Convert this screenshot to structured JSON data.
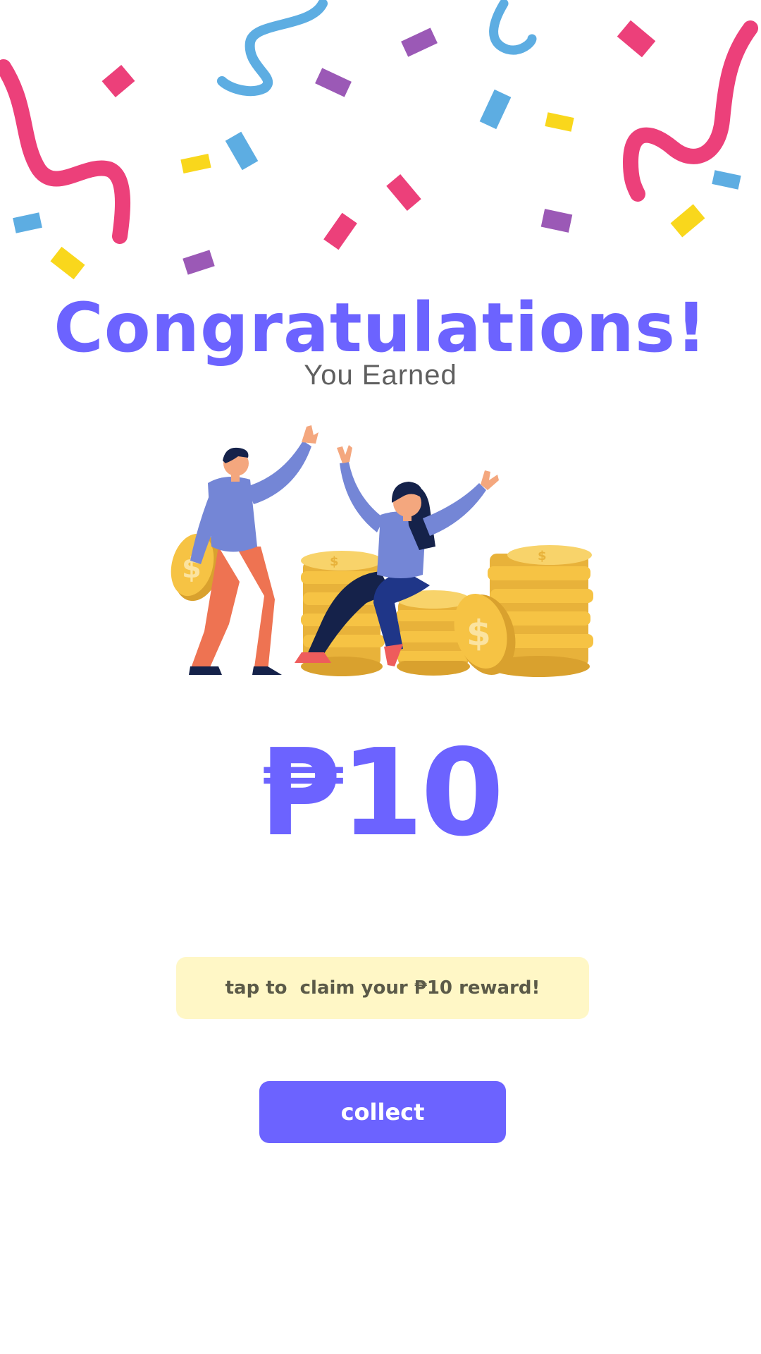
{
  "header": {
    "title": "Congratulations!",
    "subtitle": "You Earned"
  },
  "reward": {
    "amount": "₱10",
    "hint": "tap to  claim your ₱10 reward!"
  },
  "actions": {
    "collect_label": "collect"
  },
  "colors": {
    "accent": "#6C63FF",
    "hint_background": "#FFF7C6",
    "confetti_pink": "#EC407A",
    "confetti_blue": "#5DADE2",
    "confetti_purple": "#9B59B6",
    "confetti_yellow": "#F9D71C",
    "coin_gold": "#F6C344"
  },
  "icons": {
    "confetti": "confetti-decoration",
    "illustration": "people-celebrating-with-coins-illustration"
  }
}
